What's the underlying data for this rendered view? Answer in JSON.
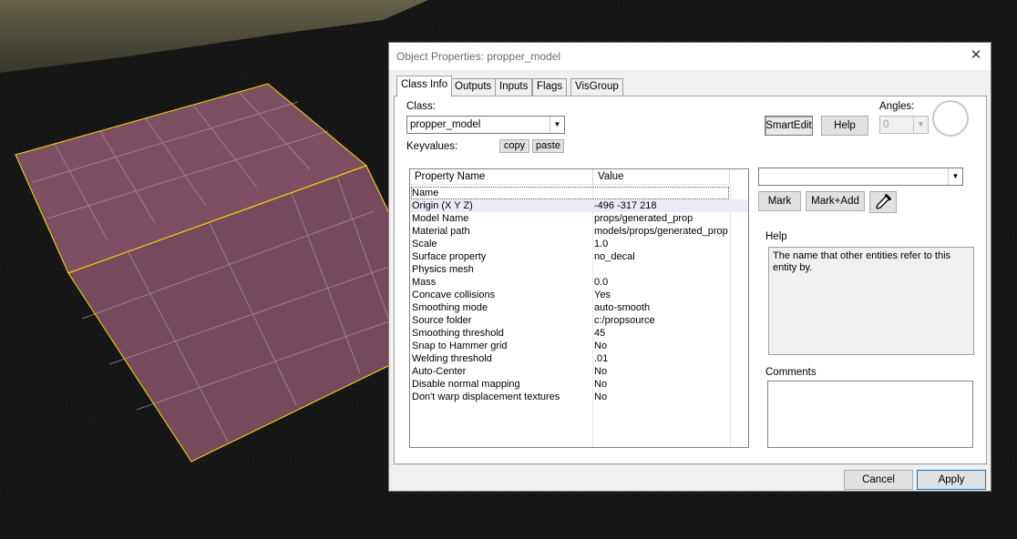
{
  "window": {
    "title": "Object Properties: propper_model"
  },
  "tabs": [
    {
      "label": "Class Info",
      "active": true
    },
    {
      "label": "Outputs"
    },
    {
      "label": "Inputs"
    },
    {
      "label": "Flags"
    },
    {
      "label": "VisGroup"
    }
  ],
  "class_info": {
    "class_label": "Class:",
    "class_value": "propper_model",
    "keyvalues_label": "Keyvalues:",
    "copy_label": "copy",
    "paste_label": "paste",
    "smartedit_label": "SmartEdit",
    "help_button_label": "Help",
    "angles_label": "Angles:",
    "angles_value": "0"
  },
  "grid": {
    "headers": [
      "Property Name",
      "Value"
    ],
    "rows": [
      {
        "name": "Name",
        "value": ""
      },
      {
        "name": "Origin (X Y Z)",
        "value": "-496 -317 218"
      },
      {
        "name": "Model Name",
        "value": "props/generated_prop"
      },
      {
        "name": "Material path",
        "value": "models/props/generated_prop"
      },
      {
        "name": "Scale",
        "value": "1.0"
      },
      {
        "name": "Surface property",
        "value": "no_decal"
      },
      {
        "name": "Physics mesh",
        "value": ""
      },
      {
        "name": "Mass",
        "value": "0.0"
      },
      {
        "name": "Concave collisions",
        "value": "Yes"
      },
      {
        "name": "Smoothing mode",
        "value": "auto-smooth"
      },
      {
        "name": "Source folder",
        "value": "c:/propsource"
      },
      {
        "name": "Smoothing threshold",
        "value": "45"
      },
      {
        "name": "Snap to Hammer grid",
        "value": "No"
      },
      {
        "name": "Welding threshold",
        "value": ".01"
      },
      {
        "name": "Auto-Center",
        "value": "No"
      },
      {
        "name": "Disable normal mapping",
        "value": "No"
      },
      {
        "name": "Don't warp displacement textures",
        "value": "No"
      }
    ]
  },
  "side_panel": {
    "value_combo": "",
    "mark_label": "Mark",
    "mark_add_label": "Mark+Add",
    "eyedropper_icon": "eyedropper-icon",
    "help_label": "Help",
    "help_text": "The name that other entities refer to this entity by.",
    "comments_label": "Comments",
    "comments_text": ""
  },
  "footer": {
    "cancel_label": "Cancel",
    "apply_label": "Apply"
  },
  "colors": {
    "brush_face": "#7c4f62",
    "brush_edge": "#ffe100",
    "ground": "#141414"
  }
}
